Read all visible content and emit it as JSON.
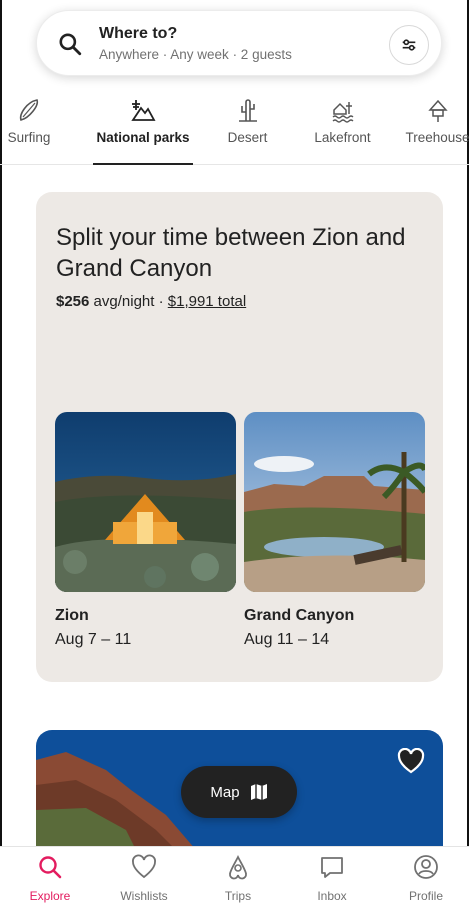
{
  "search": {
    "title": "Where to?",
    "subtitle": "Anywhere · Any week · 2 guests"
  },
  "categories": [
    {
      "label": "Surfing",
      "icon": "surfboard-icon",
      "active": false
    },
    {
      "label": "National parks",
      "icon": "national-park-icon",
      "active": true
    },
    {
      "label": "Desert",
      "icon": "cactus-icon",
      "active": false
    },
    {
      "label": "Lakefront",
      "icon": "lakefront-icon",
      "active": false
    },
    {
      "label": "Treehouse",
      "icon": "treehouse-icon",
      "active": false
    }
  ],
  "card": {
    "headline": "Split your time between Zion and Grand Canyon",
    "price_bold": "$256",
    "price_rest": " avg/night · ",
    "total": "$1,991 total",
    "destinations": [
      {
        "name": "Zion",
        "dates": "Aug 7 – 11"
      },
      {
        "name": "Grand Canyon",
        "dates": "Aug 11 – 14"
      }
    ]
  },
  "map_button": {
    "label": "Map",
    "icon": "map-icon"
  },
  "nav": [
    {
      "label": "Explore",
      "icon": "search-icon",
      "active": true
    },
    {
      "label": "Wishlists",
      "icon": "heart-icon",
      "active": false
    },
    {
      "label": "Trips",
      "icon": "airbnb-logo-icon",
      "active": false
    },
    {
      "label": "Inbox",
      "icon": "message-icon",
      "active": false
    },
    {
      "label": "Profile",
      "icon": "profile-icon",
      "active": false
    }
  ],
  "colors": {
    "accent": "#e31c5f",
    "card_bg": "#ede9e5",
    "text": "#222222",
    "muted": "#717171"
  }
}
